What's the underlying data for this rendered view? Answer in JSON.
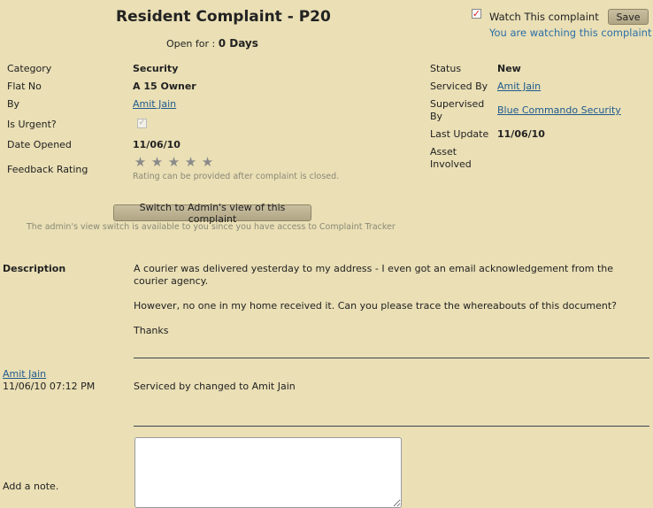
{
  "header": {
    "title": "Resident Complaint - P20",
    "open_for_label": "Open for :",
    "open_for_value": "0 Days",
    "watch_label": "Watch This complaint",
    "watch_checked": true,
    "save_label": "Save",
    "watching_text": "You are watching this complaint"
  },
  "details_left": {
    "category_label": "Category",
    "category_value": "Security",
    "flat_label": "Flat No",
    "flat_value": "A 15 Owner",
    "by_label": "By",
    "by_value": "Amit Jain",
    "urgent_label": "Is Urgent?",
    "urgent_checked": true,
    "date_label": "Date Opened",
    "date_value": "11/06/10",
    "feedback_label": "Feedback Rating",
    "rating_stars": 5,
    "rating_hint": "Rating can be provided after complaint is closed."
  },
  "details_right": {
    "status_label": "Status",
    "status_value": "New",
    "serviced_label": "Serviced By",
    "serviced_value": "Amit Jain",
    "supervised_label_1": "Supervised",
    "supervised_label_2": "By",
    "supervised_value": "Blue Commando Security",
    "last_update_label": "Last Update",
    "last_update_value": "11/06/10",
    "asset_label_1": "Asset",
    "asset_label_2": "Involved"
  },
  "admin": {
    "button_label": "Switch to Admin's view of this complaint",
    "hint": "The admin's view switch is available to you since you have access to Complaint Tracker"
  },
  "description": {
    "label": "Description",
    "para1_line1": "A courier was delivered yesterday to my address - I even got an email acknowledgement from the",
    "para1_line2": "courier agency.",
    "para2": "However, no one in my home received it. Can you please trace the whereabouts of this document?",
    "para3": "Thanks"
  },
  "history": {
    "author": "Amit Jain",
    "timestamp": "11/06/10 07:12 PM",
    "message": "Serviced by changed to Amit Jain"
  },
  "note": {
    "label": "Add a note."
  }
}
